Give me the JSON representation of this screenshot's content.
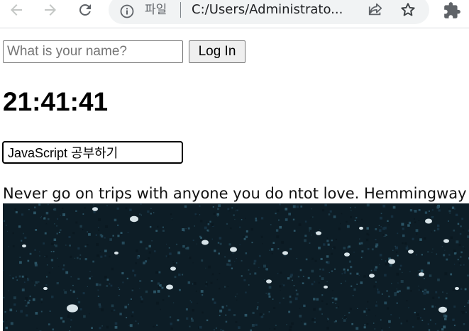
{
  "browser": {
    "site_chip_label": "파일",
    "address_url": "C:/Users/Administrato..."
  },
  "login": {
    "name_placeholder": "What is your name?",
    "login_button_label": "Log In"
  },
  "clock": {
    "time": "21:41:41"
  },
  "todo": {
    "input_value": "JavaScript 공부하기"
  },
  "quote": {
    "text": "Never go on trips with anyone you do ntot love. Hemmingway"
  },
  "icons": {
    "back": "arrow-left-icon",
    "forward": "arrow-right-icon",
    "reload": "reload-icon",
    "info": "info-icon",
    "share": "share-icon",
    "bookmark": "star-icon",
    "extensions": "puzzle-icon"
  },
  "colors": {
    "omnibox_background": "#f1f3f4",
    "image_base": "#0d1d26"
  }
}
